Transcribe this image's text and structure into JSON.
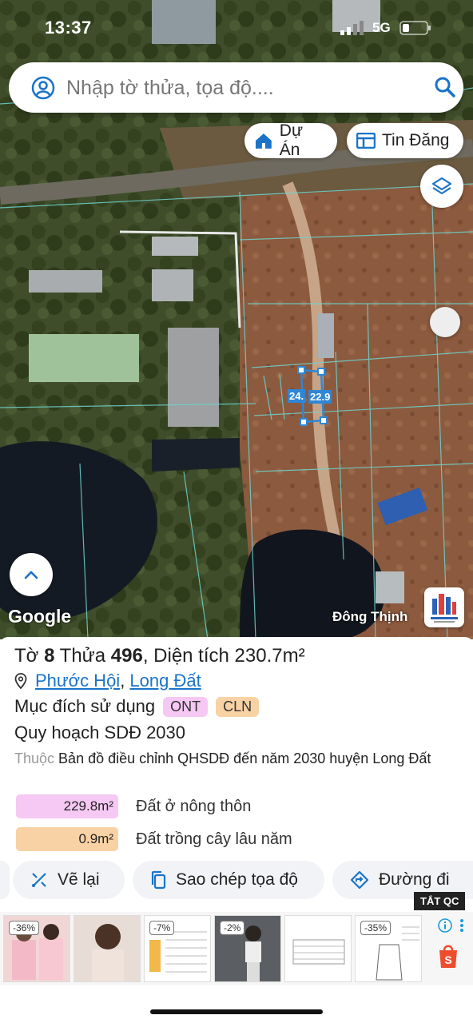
{
  "status_bar": {
    "time": "13:37",
    "network": "5G"
  },
  "search": {
    "placeholder": "Nhập tờ thửa, tọa độ...."
  },
  "map_buttons": {
    "project": "Dự Án",
    "listing": "Tin Đăng"
  },
  "map": {
    "attribution": "Google",
    "place_label": "Đông Thịnh",
    "dimension_labels": [
      "24.",
      "22.9"
    ]
  },
  "parcel": {
    "sheet_prefix": "Tờ",
    "sheet_no": "8",
    "parcel_prefix": "Thửa",
    "parcel_no": "496",
    "area_text": ", Diện tích 230.7m²",
    "ward": "Phước Hội",
    "district": "Long Đất",
    "purpose_label": "Mục đích sử dụng",
    "purpose_tags": [
      "ONT",
      "CLN"
    ],
    "plan_title": "Quy hoạch SDĐ 2030",
    "belongs_prefix": "Thuộc",
    "belongs_text": "Bản đồ điều chỉnh QHSDĐ đến năm 2030 huyện Long Đất",
    "zones": [
      {
        "area": "229.8m²",
        "label": "Đất ở nông thôn",
        "color": "#f6c8f4"
      },
      {
        "area": "0.9m²",
        "label": "Đất trồng cây lâu năm",
        "color": "#f8d2a4"
      }
    ]
  },
  "actions": {
    "redraw": "Vẽ lại",
    "copy_coords": "Sao chép tọa độ",
    "directions": "Đường đi"
  },
  "ads": {
    "close_label": "TẮT QC",
    "items": [
      {
        "badge": "-36%"
      },
      {
        "badge": ""
      },
      {
        "badge": "-7%"
      },
      {
        "badge": "-2%"
      },
      {
        "badge": ""
      },
      {
        "badge": "-35%"
      }
    ]
  },
  "colors": {
    "accent": "#1a73c9",
    "ont": "#f6c8f4",
    "cln": "#f8d2a4"
  }
}
